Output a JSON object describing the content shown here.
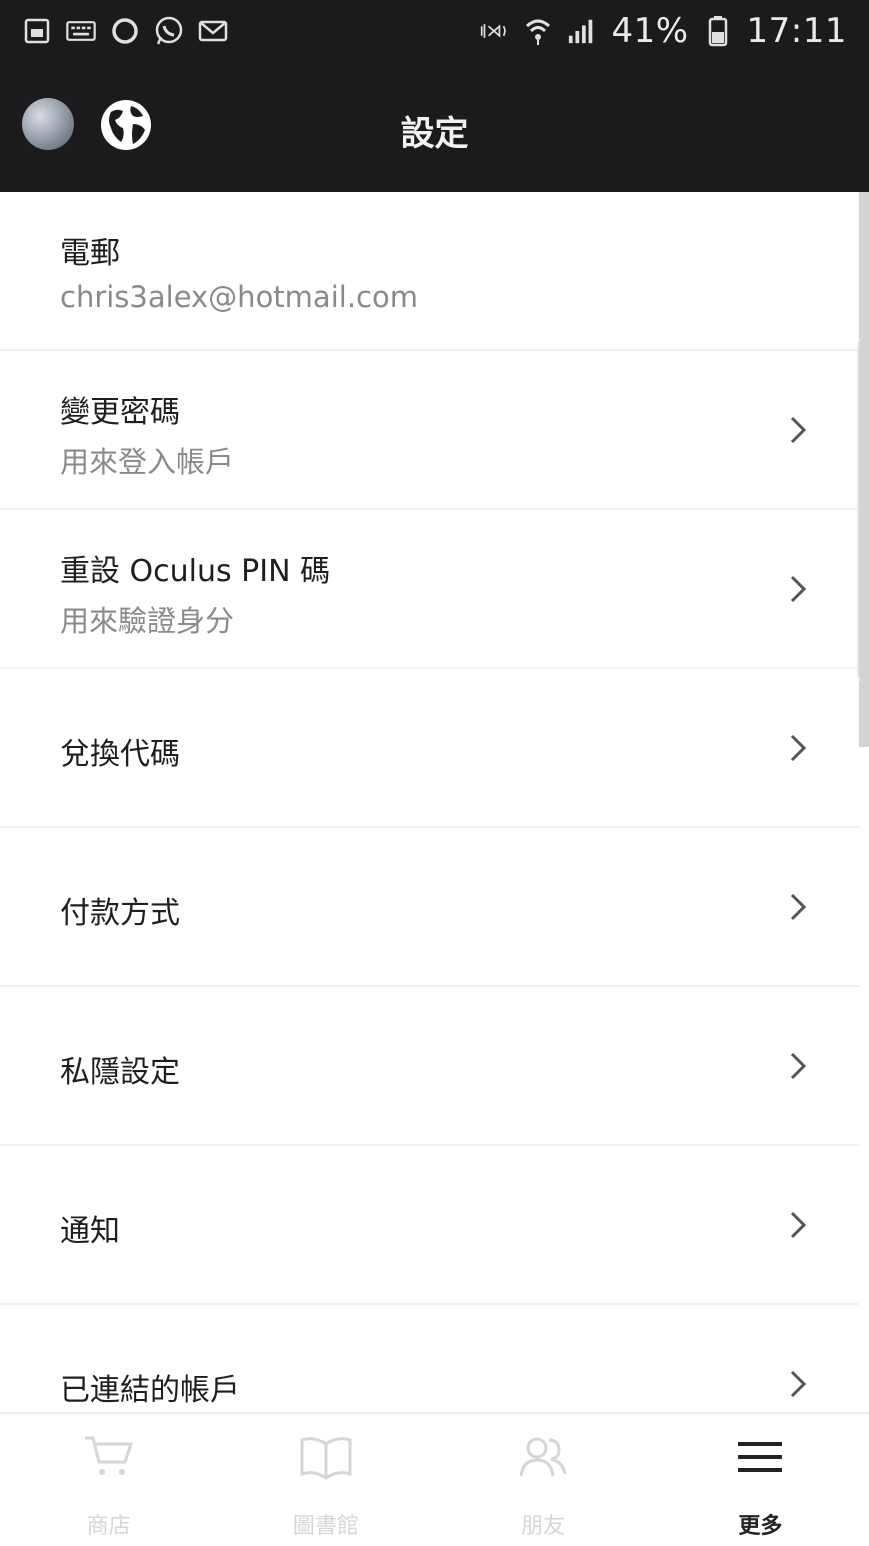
{
  "status_bar": {
    "battery": "41%",
    "time": "17:11",
    "left_icons": [
      "gallery-icon",
      "keyboard-icon",
      "circle-icon",
      "whatsapp-icon",
      "mail-icon"
    ],
    "right_icons": [
      "nfc-mute-icon",
      "wifi-icon",
      "signal-icon",
      "battery-icon"
    ]
  },
  "app_bar": {
    "title": "設定"
  },
  "settings": {
    "email": {
      "title": "電郵",
      "value": "chris3alex@hotmail.com"
    },
    "change_password": {
      "title": "變更密碼",
      "subtitle": "用來登入帳戶"
    },
    "reset_pin": {
      "title": "重設 Oculus PIN 碼",
      "subtitle": "用來驗證身分"
    },
    "redeem_code": {
      "title": "兌換代碼"
    },
    "payment": {
      "title": "付款方式"
    },
    "privacy": {
      "title": "私隱設定"
    },
    "notifications": {
      "title": "通知"
    },
    "linked_accounts": {
      "title": "已連結的帳戶"
    }
  },
  "bottom_nav": {
    "items": [
      {
        "label": "商店",
        "icon": "cart-icon"
      },
      {
        "label": "圖書館",
        "icon": "book-icon"
      },
      {
        "label": "朋友",
        "icon": "friends-icon"
      },
      {
        "label": "更多",
        "icon": "menu-icon"
      }
    ],
    "active_index": 3
  },
  "colors": {
    "header_bg": "#1b1b1d",
    "active_nav": "#222222",
    "inactive_nav": "#d6d6d6"
  }
}
